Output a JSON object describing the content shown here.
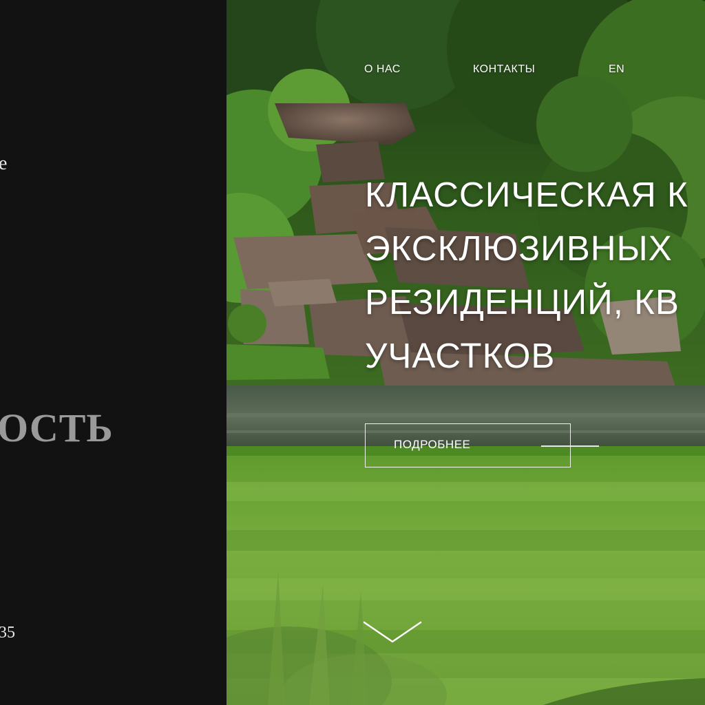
{
  "nav": {
    "about": "О НАС",
    "contacts": "КОНТАКТЫ",
    "lang": "EN"
  },
  "hero": {
    "headline_lines": [
      "КЛАССИЧЕСКАЯ К",
      "ЭКСКЛЮЗИВНЫХ",
      "РЕЗИДЕНЦИЙ, КВ",
      "УЧАСТКОВ"
    ],
    "cta_label": "ПОДРОБНЕЕ"
  },
  "left_panel": {
    "fragment_top": "e",
    "fragment_middle": "ОСТЬ",
    "fragment_bottom": "35"
  },
  "icons": {
    "scroll": "chevron-down-icon"
  },
  "colors": {
    "panel": "#121212",
    "text": "#ffffff",
    "muted_text": "#9a9a9a",
    "lawn": "#6fa83a"
  }
}
